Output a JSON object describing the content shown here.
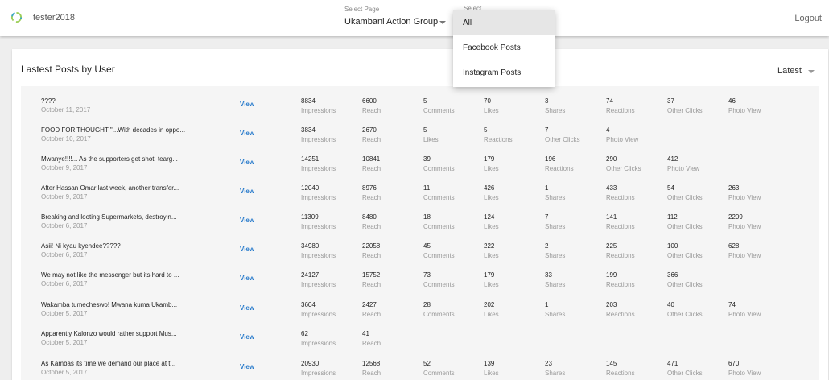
{
  "header": {
    "username": "tester2018",
    "select_page_label": "Select Page",
    "select_page_value": "Ukambani Action Group",
    "select_type_label": "Select",
    "logout": "Logout"
  },
  "card": {
    "title": "Lastest Posts by User",
    "sort_value": "Latest",
    "view_label": "View"
  },
  "dropdown": {
    "options": [
      "All",
      "Facebook Posts",
      "Instagram Posts"
    ],
    "selected": "All"
  },
  "posts": [
    {
      "text": "????",
      "date": "October 11, 2017",
      "metrics": [
        {
          "value": "8834",
          "label": "Impressions"
        },
        {
          "value": "6600",
          "label": "Reach"
        },
        {
          "value": "5",
          "label": "Comments"
        },
        {
          "value": "70",
          "label": "Likes"
        },
        {
          "value": "3",
          "label": "Shares"
        },
        {
          "value": "74",
          "label": "Reactions"
        },
        {
          "value": "37",
          "label": "Other Clicks"
        },
        {
          "value": "46",
          "label": "Photo View"
        }
      ]
    },
    {
      "text": "FOOD FOR THOUGHT \"...With decades in oppo...",
      "date": "October 10, 2017",
      "metrics": [
        {
          "value": "3834",
          "label": "Impressions"
        },
        {
          "value": "2670",
          "label": "Reach"
        },
        {
          "value": "5",
          "label": "Likes"
        },
        {
          "value": "5",
          "label": "Reactions"
        },
        {
          "value": "7",
          "label": "Other Clicks"
        },
        {
          "value": "4",
          "label": "Photo View"
        }
      ]
    },
    {
      "text": "Mwanye!!!!... As the supporters get shot, tearg...",
      "date": "October 9, 2017",
      "metrics": [
        {
          "value": "14251",
          "label": "Impressions"
        },
        {
          "value": "10841",
          "label": "Reach"
        },
        {
          "value": "39",
          "label": "Comments"
        },
        {
          "value": "179",
          "label": "Likes"
        },
        {
          "value": "196",
          "label": "Reactions"
        },
        {
          "value": "290",
          "label": "Other Clicks"
        },
        {
          "value": "412",
          "label": "Photo View"
        }
      ]
    },
    {
      "text": "After Hassan Omar last week, another transfer...",
      "date": "October 9, 2017",
      "metrics": [
        {
          "value": "12040",
          "label": "Impressions"
        },
        {
          "value": "8976",
          "label": "Reach"
        },
        {
          "value": "11",
          "label": "Comments"
        },
        {
          "value": "426",
          "label": "Likes"
        },
        {
          "value": "1",
          "label": "Shares"
        },
        {
          "value": "433",
          "label": "Reactions"
        },
        {
          "value": "54",
          "label": "Other Clicks"
        },
        {
          "value": "263",
          "label": "Photo View"
        }
      ]
    },
    {
      "text": "Breaking and looting Supermarkets, destroyin...",
      "date": "October 6, 2017",
      "metrics": [
        {
          "value": "11309",
          "label": "Impressions"
        },
        {
          "value": "8480",
          "label": "Reach"
        },
        {
          "value": "18",
          "label": "Comments"
        },
        {
          "value": "124",
          "label": "Likes"
        },
        {
          "value": "7",
          "label": "Shares"
        },
        {
          "value": "141",
          "label": "Reactions"
        },
        {
          "value": "112",
          "label": "Other Clicks"
        },
        {
          "value": "2209",
          "label": "Photo View"
        }
      ]
    },
    {
      "text": "Asii! Ni kyau kyendee?????",
      "date": "October 6, 2017",
      "metrics": [
        {
          "value": "34980",
          "label": "Impressions"
        },
        {
          "value": "22058",
          "label": "Reach"
        },
        {
          "value": "45",
          "label": "Comments"
        },
        {
          "value": "222",
          "label": "Likes"
        },
        {
          "value": "2",
          "label": "Shares"
        },
        {
          "value": "225",
          "label": "Reactions"
        },
        {
          "value": "100",
          "label": "Other Clicks"
        },
        {
          "value": "628",
          "label": "Photo View"
        }
      ]
    },
    {
      "text": "We may not like the messenger but its hard to ...",
      "date": "October 6, 2017",
      "metrics": [
        {
          "value": "24127",
          "label": "Impressions"
        },
        {
          "value": "15752",
          "label": "Reach"
        },
        {
          "value": "73",
          "label": "Comments"
        },
        {
          "value": "179",
          "label": "Likes"
        },
        {
          "value": "33",
          "label": "Shares"
        },
        {
          "value": "199",
          "label": "Reactions"
        },
        {
          "value": "366",
          "label": "Other Clicks"
        }
      ]
    },
    {
      "text": "Wakamba tumecheswo! Mwana kuma Ukamb...",
      "date": "October 5, 2017",
      "metrics": [
        {
          "value": "3604",
          "label": "Impressions"
        },
        {
          "value": "2427",
          "label": "Reach"
        },
        {
          "value": "28",
          "label": "Comments"
        },
        {
          "value": "202",
          "label": "Likes"
        },
        {
          "value": "1",
          "label": "Shares"
        },
        {
          "value": "203",
          "label": "Reactions"
        },
        {
          "value": "40",
          "label": "Other Clicks"
        },
        {
          "value": "74",
          "label": "Photo View"
        }
      ]
    },
    {
      "text": "Apparently Kalonzo would rather support Mus...",
      "date": "October 5, 2017",
      "metrics": [
        {
          "value": "62",
          "label": "Impressions"
        },
        {
          "value": "41",
          "label": "Reach"
        }
      ]
    },
    {
      "text": "As Kambas its time we demand our place at t...",
      "date": "October 5, 2017",
      "metrics": [
        {
          "value": "20930",
          "label": "Impressions"
        },
        {
          "value": "12568",
          "label": "Reach"
        },
        {
          "value": "52",
          "label": "Comments"
        },
        {
          "value": "139",
          "label": "Likes"
        },
        {
          "value": "23",
          "label": "Shares"
        },
        {
          "value": "145",
          "label": "Reactions"
        },
        {
          "value": "471",
          "label": "Other Clicks"
        },
        {
          "value": "670",
          "label": "Photo View"
        }
      ]
    }
  ]
}
